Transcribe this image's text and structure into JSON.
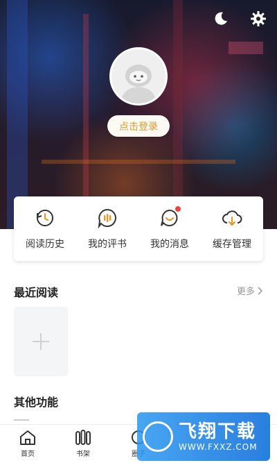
{
  "header": {
    "moon_icon": "moon-icon",
    "settings_icon": "gear-icon",
    "avatar_icon": "default-avatar",
    "login_label": "点击登录"
  },
  "quick": {
    "items": [
      {
        "label": "阅读历史",
        "icon": "history-icon"
      },
      {
        "label": "我的评书",
        "icon": "audio-comment-icon"
      },
      {
        "label": "我的消息",
        "icon": "message-icon"
      },
      {
        "label": "缓存管理",
        "icon": "cloud-download-icon"
      }
    ],
    "accent": "#e49a2a",
    "badge_color": "#f0423b"
  },
  "recent": {
    "title": "最近阅读",
    "more": "更多"
  },
  "other": {
    "title": "其他功能"
  },
  "nav": {
    "items": [
      {
        "label": "首页",
        "icon": "home-icon"
      },
      {
        "label": "书架",
        "icon": "bookshelf-icon"
      },
      {
        "label": "圈子",
        "icon": "circle-icon"
      },
      {
        "label": "",
        "icon": "hidden-icon"
      },
      {
        "label": "",
        "icon": "hidden-icon"
      }
    ]
  },
  "watermark": {
    "title": "飞翔下载",
    "url": "WWW.FXXZ.COM"
  }
}
